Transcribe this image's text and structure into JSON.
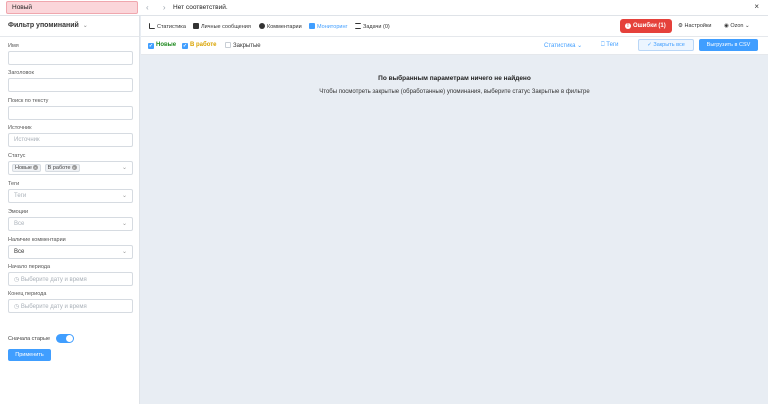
{
  "topbar": {
    "search_value": "Новый",
    "nav_arrows": "‹ ›",
    "not_found_text": "Нет соответствий.",
    "close": "×"
  },
  "sidebar": {
    "title": "Фильтр упоминаний",
    "fields": [
      {
        "label": "Имя",
        "value": "",
        "placeholder": ""
      },
      {
        "label": "Заголовок",
        "value": "",
        "placeholder": ""
      },
      {
        "label": "Поиск по тексту",
        "value": "",
        "placeholder": ""
      },
      {
        "label": "Источник",
        "value": "",
        "placeholder": "Источник"
      }
    ],
    "status": {
      "label": "Статус",
      "tags": [
        "Новые",
        "В работе"
      ]
    },
    "tags_field": {
      "label": "Теги",
      "placeholder": "Теги"
    },
    "emotions": {
      "label": "Эмоции",
      "placeholder": "Все"
    },
    "comments": {
      "label": "Наличие комментарии",
      "value": "Все"
    },
    "period_start": {
      "label": "Начало периода",
      "placeholder": "Выберите дату и время"
    },
    "period_end": {
      "label": "Конец периода",
      "placeholder": "Выберите дату и время"
    },
    "old_first": {
      "label": "Сначала старые",
      "on": true
    },
    "apply_label": "Применить"
  },
  "nav": {
    "items": [
      {
        "label": "Статистика",
        "icon": "chart-icon",
        "active": false
      },
      {
        "label": "Личные сообщения",
        "icon": "mail-icon",
        "active": false
      },
      {
        "label": "Комментарии",
        "icon": "comment-icon",
        "active": false
      },
      {
        "label": "Мониторинг",
        "icon": "monitor-icon",
        "active": true
      },
      {
        "label": "Задачи (0)",
        "icon": "tasks-icon",
        "active": false
      }
    ],
    "errors_label": "Ошибки (1)",
    "settings_label": "Настройки",
    "user_label": "Ozon"
  },
  "filters": {
    "new_label": "Новые",
    "in_work_label": "В работе",
    "closed_label": "Закрытые",
    "stats_label": "Статистика",
    "tags_label": "Теги",
    "close_all_label": "Закрыть все",
    "export_label": "Выгрузить в CSV"
  },
  "empty_state": {
    "title": "По выбранным параметрам ничего не найдено",
    "subtitle": "Чтобы посмотреть закрытые (обработанные) упоминания, выберите статус Закрытые в фильтре"
  },
  "colors": {
    "accent": "#409eff",
    "error": "#e5413b",
    "new_status": "#1f8a1f",
    "in_work_status": "#d9a300"
  }
}
